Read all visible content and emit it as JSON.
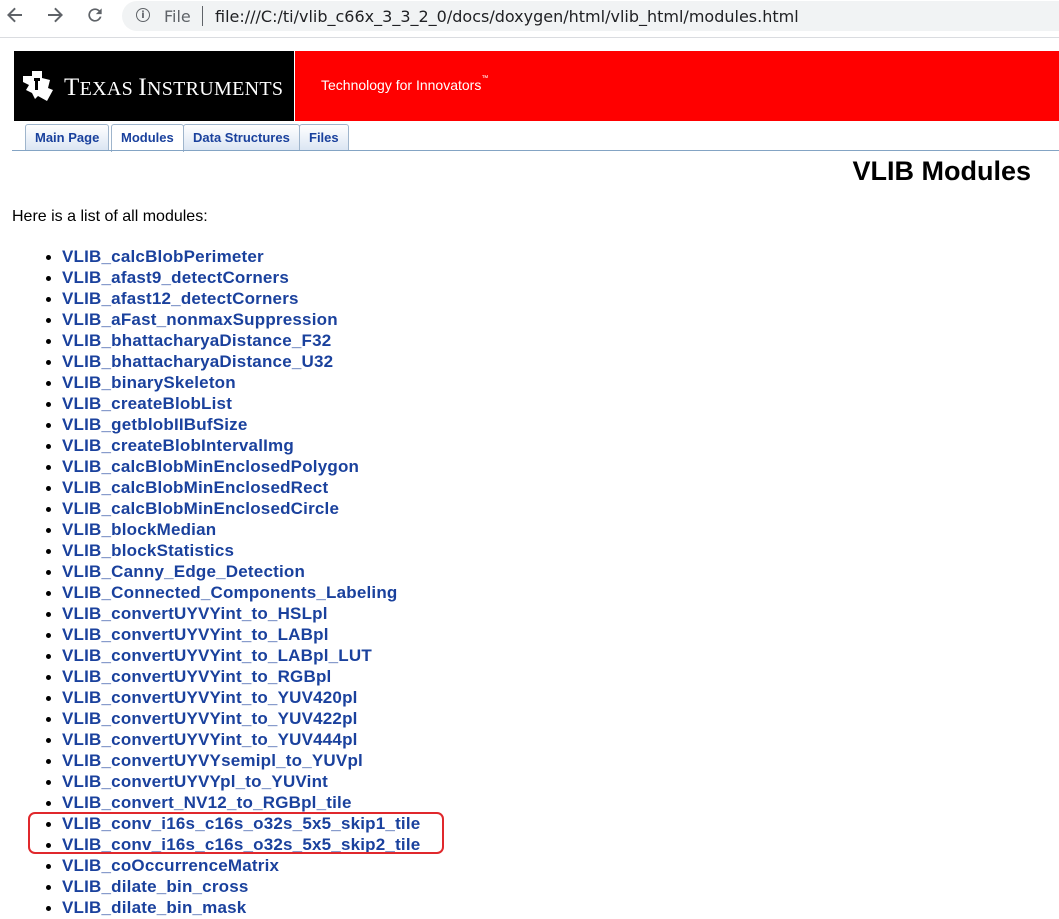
{
  "browser": {
    "scheme_label": "File",
    "url": "file:///C:/ti/vlib_c66x_3_3_2_0/docs/doxygen/html/vlib_html/modules.html"
  },
  "header": {
    "logo_first": "T",
    "logo_rest1": "EXAS ",
    "logo_second": "I",
    "logo_rest2": "NSTRUMENTS",
    "tagline": "Technology for Innovators",
    "tagline_mark": "™"
  },
  "tabs": [
    {
      "label": "Main Page",
      "active": false
    },
    {
      "label": "Modules",
      "active": true
    },
    {
      "label": "Data Structures",
      "active": false
    },
    {
      "label": "Files",
      "active": false
    }
  ],
  "page": {
    "title": "VLIB Modules",
    "intro": "Here is a list of all modules:"
  },
  "modules": [
    "VLIB_calcBlobPerimeter",
    "VLIB_afast9_detectCorners",
    "VLIB_afast12_detectCorners",
    "VLIB_aFast_nonmaxSuppression",
    "VLIB_bhattacharyaDistance_F32",
    "VLIB_bhattacharyaDistance_U32",
    "VLIB_binarySkeleton",
    "VLIB_createBlobList",
    "VLIB_getblobIIBufSize",
    "VLIB_createBlobIntervalImg",
    "VLIB_calcBlobMinEnclosedPolygon",
    "VLIB_calcBlobMinEnclosedRect",
    "VLIB_calcBlobMinEnclosedCircle",
    "VLIB_blockMedian",
    "VLIB_blockStatistics",
    "VLIB_Canny_Edge_Detection",
    "VLIB_Connected_Components_Labeling",
    "VLIB_convertUYVYint_to_HSLpl",
    "VLIB_convertUYVYint_to_LABpl",
    "VLIB_convertUYVYint_to_LABpl_LUT",
    "VLIB_convertUYVYint_to_RGBpl",
    "VLIB_convertUYVYint_to_YUV420pl",
    "VLIB_convertUYVYint_to_YUV422pl",
    "VLIB_convertUYVYint_to_YUV444pl",
    "VLIB_convertUYVYsemipl_to_YUVpl",
    "VLIB_convertUYVYpl_to_YUVint",
    "VLIB_convert_NV12_to_RGBpl_tile",
    "VLIB_conv_i16s_c16s_o32s_5x5_skip1_tile",
    "VLIB_conv_i16s_c16s_o32s_5x5_skip2_tile",
    "VLIB_coOccurrenceMatrix",
    "VLIB_dilate_bin_cross",
    "VLIB_dilate_bin_mask"
  ],
  "colors": {
    "link": "#1a419d",
    "header_red": "#ff0000",
    "highlight": "#e0282c"
  }
}
